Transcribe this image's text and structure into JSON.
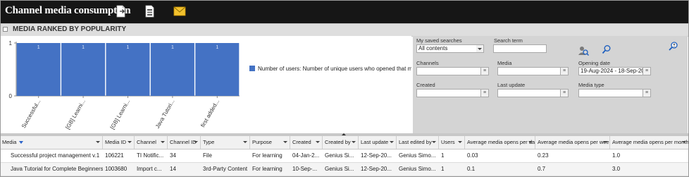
{
  "app": {
    "title": "Channel media consumption",
    "toolbar_icons": [
      "export-document-icon",
      "report-document-icon",
      "email-icon"
    ]
  },
  "panel": {
    "title": "MEDIA RANKED BY POPULARITY"
  },
  "chart_data": {
    "type": "bar",
    "categories": [
      "Successful...",
      "[GB] Learni...",
      "[GB] Learni...",
      "Java Tutori...",
      "first added..."
    ],
    "values": [
      1,
      1,
      1,
      1,
      1
    ],
    "data_labels": [
      "1",
      "1",
      "1",
      "1",
      "1"
    ],
    "y_ticks": [
      "0",
      "1"
    ],
    "ylim": [
      0,
      1
    ],
    "series": [
      {
        "name": "Number of users: Number of unique users who opened that media",
        "values": [
          1,
          1,
          1,
          1,
          1
        ],
        "color": "#4472c4"
      }
    ],
    "legend_position": "right",
    "grid": false
  },
  "filters": {
    "saved_searches_label": "My saved searches",
    "saved_searches_value": "All contents",
    "search_term_label": "Search term",
    "search_term_value": "",
    "channels_label": "Channels",
    "media_label": "Media",
    "opening_date_label": "Opening date",
    "opening_date_value": "19-Aug-2024 - 18-Sep-20",
    "created_label": "Created",
    "last_update_label": "Last update",
    "media_type_label": "Media type"
  },
  "table": {
    "columns": [
      {
        "label": "Media",
        "sorted": true
      },
      {
        "label": "Media ID"
      },
      {
        "label": "Channel"
      },
      {
        "label": "Channel ID"
      },
      {
        "label": "Type"
      },
      {
        "label": "Purpose"
      },
      {
        "label": "Created"
      },
      {
        "label": "Created by"
      },
      {
        "label": "Last update"
      },
      {
        "label": "Last edited by"
      },
      {
        "label": "Users"
      },
      {
        "label": "Average media opens per day"
      },
      {
        "label": "Average media opens per week"
      },
      {
        "label": "Average media opens per month"
      }
    ],
    "rows": [
      [
        "Successful project management v.1",
        "106221",
        "TI Notific...",
        "34",
        "File",
        "For learning",
        "04-Jan-2...",
        "Genius Si...",
        "12-Sep-20...",
        "Genius Simo...",
        "1",
        "0.03",
        "0.23",
        "1.0"
      ],
      [
        "Java Tutorial for Complete Beginners",
        "1003680",
        "Import c...",
        "14",
        "3rd-Party Content",
        "For learning",
        "10-Sep-...",
        "Genius Si...",
        "12-Sep-20...",
        "Genius Simo...",
        "1",
        "0.1",
        "0.7",
        "3.0"
      ]
    ]
  }
}
